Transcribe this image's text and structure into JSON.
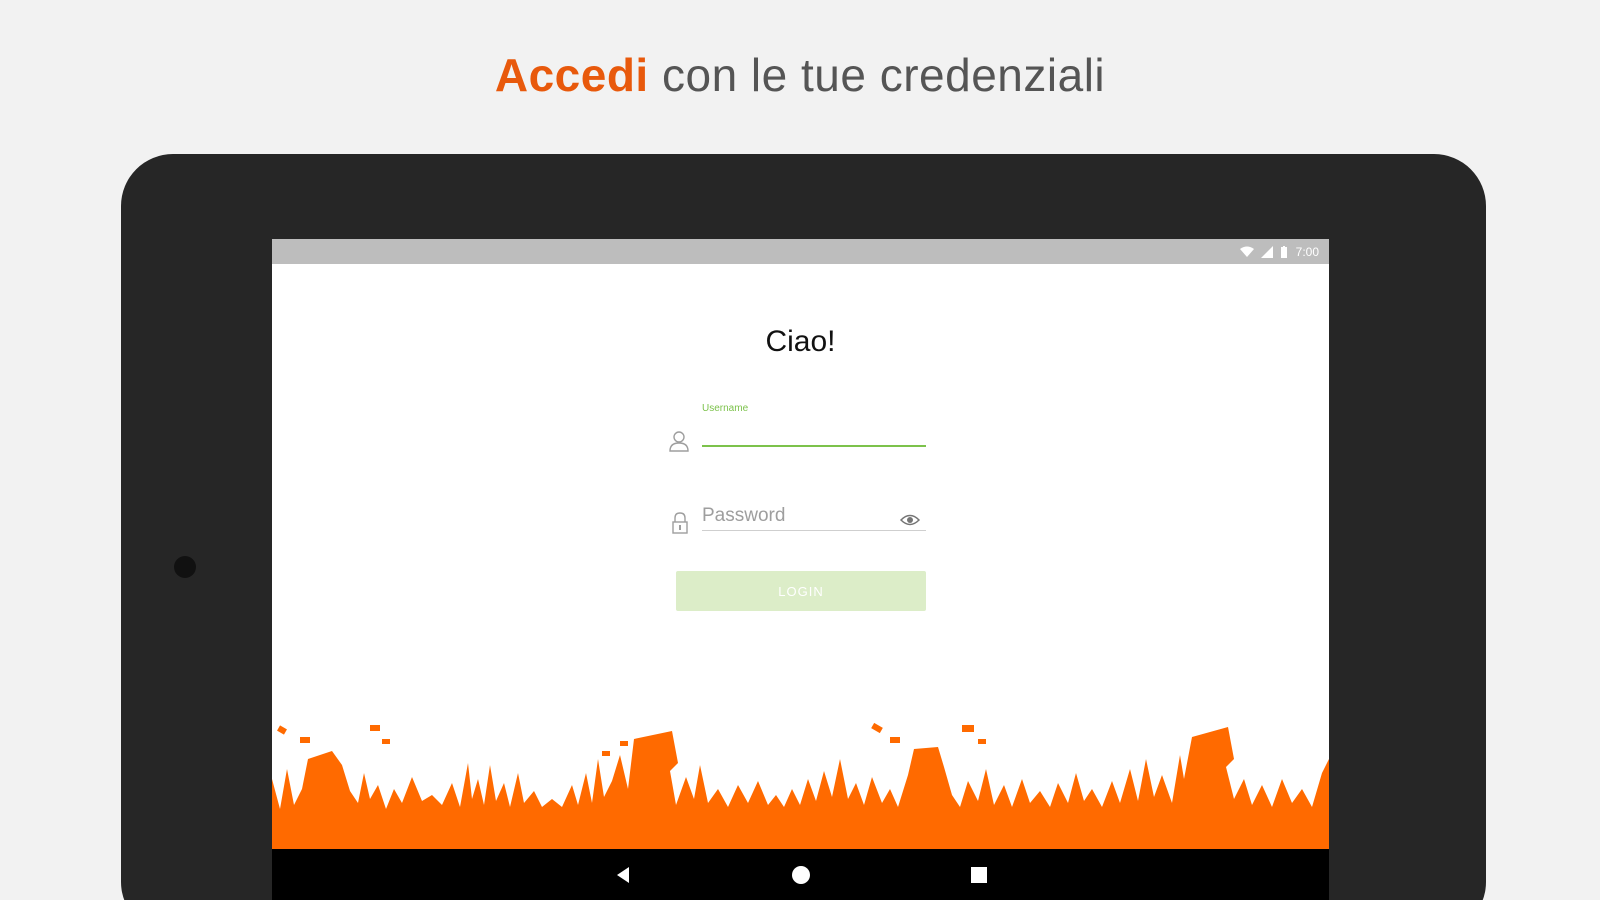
{
  "headline": {
    "accent": "Accedi",
    "rest": " con le tue credenziali"
  },
  "status_bar": {
    "time": "7:00",
    "icons": [
      "wifi-icon",
      "signal-icon",
      "battery-icon"
    ]
  },
  "login": {
    "greeting": "Ciao!",
    "username_label": "Username",
    "username_value": "",
    "password_placeholder": "Password",
    "password_value": "",
    "login_label": "LOGIN"
  },
  "nav": {
    "icons": [
      "back-icon",
      "home-icon",
      "recents-icon"
    ]
  },
  "colors": {
    "accent": "#e8590c",
    "crowd": "#ff6a00",
    "field_active": "#7cc24b",
    "button_disabled": "#dcedc8",
    "tablet_frame": "#262626"
  }
}
